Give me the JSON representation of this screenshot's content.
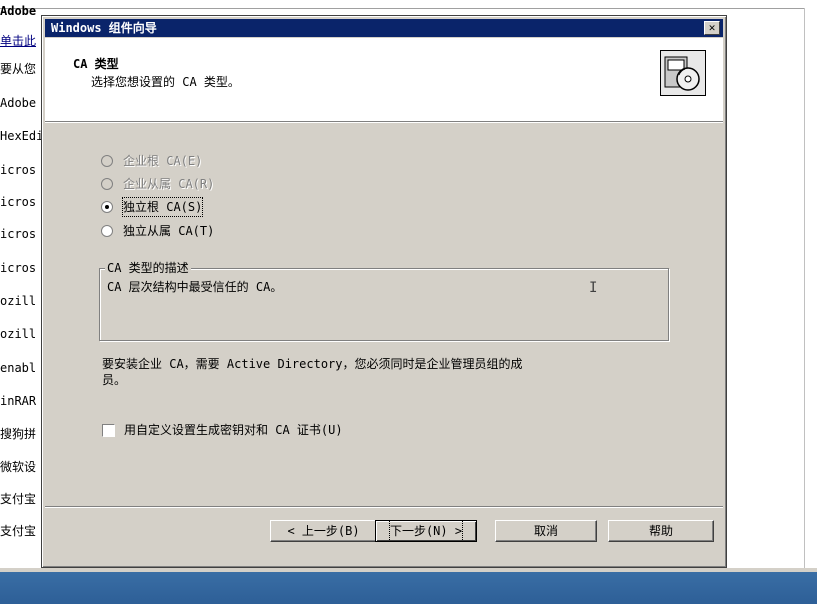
{
  "background_list": {
    "items": [
      {
        "label": "Adobe",
        "bold": true
      },
      {
        "label": "单击此",
        "link": true
      },
      {
        "label": "要从您"
      },
      {
        "label": "Adobe"
      },
      {
        "label": "HexEdi"
      },
      {
        "label": "icros"
      },
      {
        "label": "icros"
      },
      {
        "label": "icros"
      },
      {
        "label": "icros"
      },
      {
        "label": "ozill"
      },
      {
        "label": "ozill"
      },
      {
        "label": "enabl"
      },
      {
        "label": "inRAR"
      },
      {
        "label": "搜狗拼"
      },
      {
        "label": "微软设"
      },
      {
        "label": "支付宝"
      },
      {
        "label": "支付宝"
      }
    ]
  },
  "dialog": {
    "title": "Windows 组件向导",
    "close_label": "✕",
    "header": {
      "title": "CA 类型",
      "subtitle": "选择您想设置的 CA 类型。",
      "icon": "setup-disk-icon"
    },
    "options": [
      {
        "label": "企业根 CA(E)",
        "selected": false,
        "disabled": true
      },
      {
        "label": "企业从属 CA(R)",
        "selected": false,
        "disabled": true
      },
      {
        "label": "独立根 CA(S)",
        "selected": true,
        "disabled": false
      },
      {
        "label": "独立从属 CA(T)",
        "selected": false,
        "disabled": false
      }
    ],
    "description": {
      "legend": "CA 类型的描述",
      "text": "CA 层次结构中最受信任的 CA。"
    },
    "note_line1": "要安装企业 CA，需要 Active Directory，您必须同时是企业管理员组的成",
    "note_line2": "员。",
    "checkbox": {
      "label": "用自定义设置生成密钥对和 CA 证书(U)",
      "checked": false
    },
    "buttons": {
      "back": "< 上一步(B)",
      "next": "下一步(N) >",
      "cancel": "取消",
      "help": "帮助"
    }
  },
  "colors": {
    "titlebar": "#0a246a",
    "face": "#d4d0c8",
    "taskbar": "#3a6ea5"
  }
}
